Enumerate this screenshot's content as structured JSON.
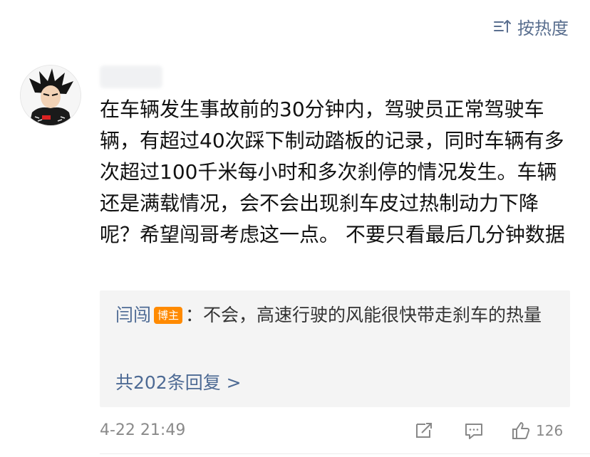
{
  "sort": {
    "label": "按热度",
    "icon": "sort-hot-icon"
  },
  "comment": {
    "username": "",
    "text": "在车辆发生事故前的30分钟内，驾驶员正常驾驶车辆，有超过40次踩下制动踏板的记录，同时车辆有多次超过100千米每小时和多次刹停的情况发生。车辆还是满载情况，会不会出现刹车皮过热制动力下降呢？希望闯哥考虑这一点。 不要只看最后几分钟数据",
    "time": "4-22 21:49",
    "like_count": "126"
  },
  "reply": {
    "author": "闫闯",
    "badge": "博主",
    "separator": "：",
    "text": "不会，高速行驶的风能很快带走刹车的热量",
    "more": "共202条回复 >"
  },
  "icons": {
    "share": "share-icon",
    "comment": "comment-icon",
    "like": "like-icon"
  },
  "colors": {
    "link": "#4d6a94",
    "badge": "#ff8a00",
    "reply_bg": "#f4f4f4",
    "meta": "#8a8a8a"
  }
}
